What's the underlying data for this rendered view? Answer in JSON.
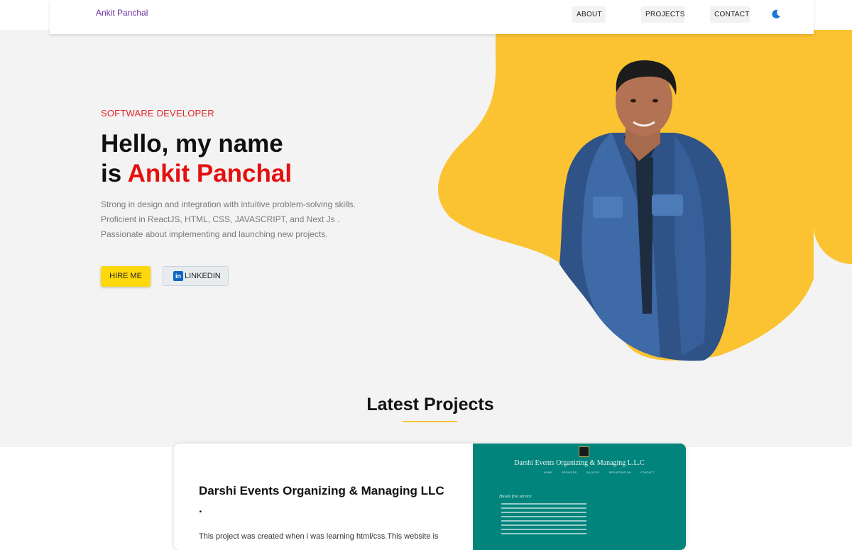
{
  "navbar": {
    "brand": "Ankit Panchal",
    "links": [
      "ABOUT",
      "PROJECTS",
      "CONTACT"
    ],
    "theme_toggle_icon": "moon-icon"
  },
  "hero": {
    "role": "SOFTWARE DEVELOPER",
    "title_line1": "Hello, my name",
    "title_line2_prefix": "is ",
    "title_name": "Ankit Panchal",
    "desc_line1": "Strong in design and integration with intuitive problem-solving skills.",
    "desc_line2": "Proficient in ReactJS, HTML, CSS, JAVASCRIPT, and Next Js .",
    "desc_line3": "Passionate about implementing and launching new projects.",
    "hire_label": "HIRE ME",
    "linkedin_label": "LINKEDIN",
    "linkedin_icon": "linkedin-icon",
    "photo": "profile-photo"
  },
  "projects": {
    "heading": "Latest Projects",
    "items": [
      {
        "title": "Darshi Events Organizing & Managing LLC .",
        "desc": "This project was created when i was learning html/css.This website is",
        "thumb_title": "Darshi Events Organizing & Managing L.L.C",
        "thumb_nav": [
          "HOME",
          "SERVICES",
          "GALLERY",
          "REGISTRATION",
          "CONTACT"
        ],
        "thumb_subtitle": "Hassle free service"
      }
    ]
  },
  "colors": {
    "accent_yellow": "#fbc332",
    "accent_red": "#e60f0f",
    "brand_purple": "#6a2fa0",
    "thumb_teal": "#01847c"
  }
}
